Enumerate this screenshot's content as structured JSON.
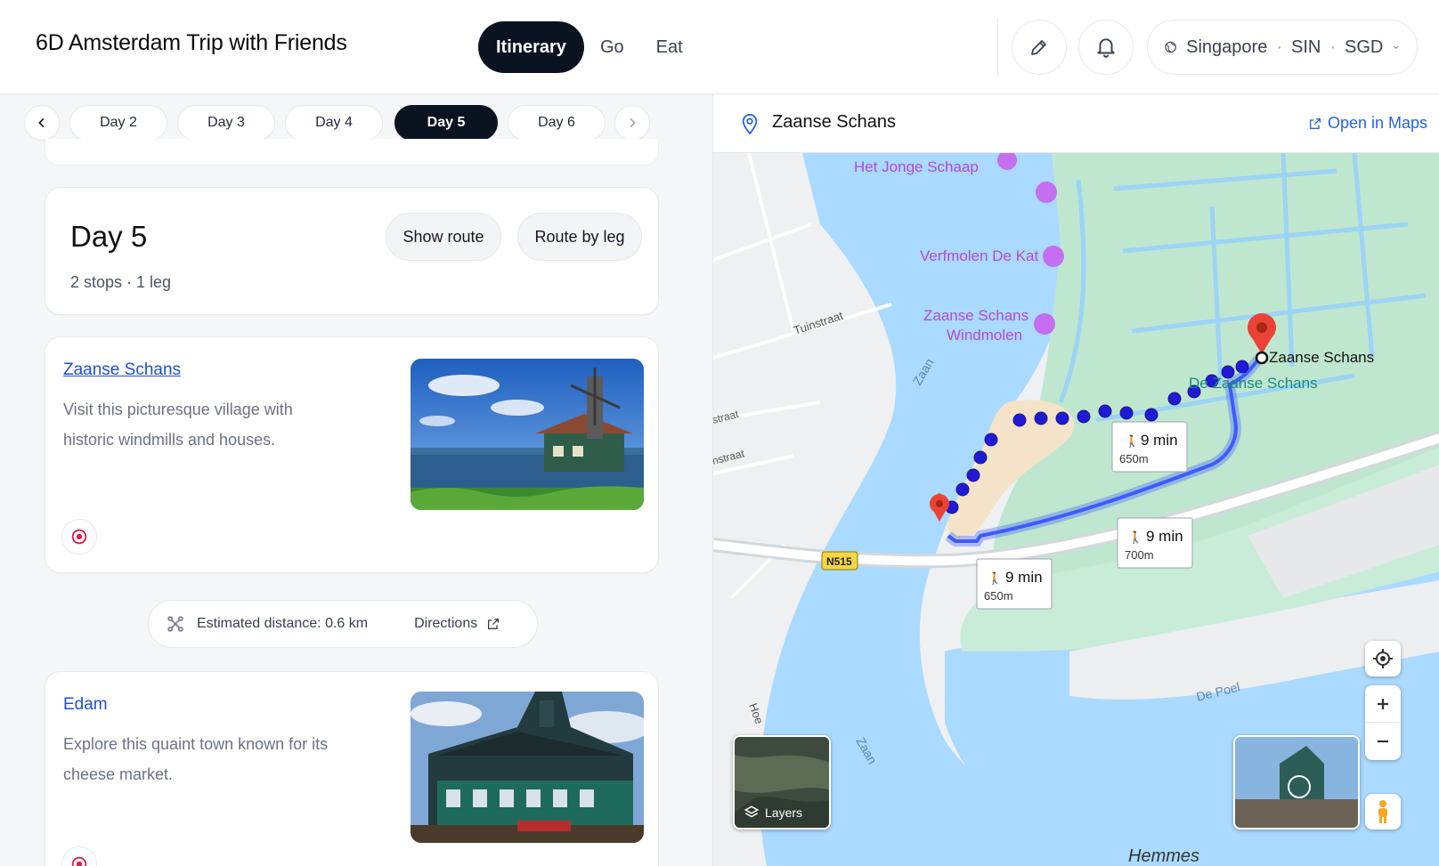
{
  "header": {
    "trip_title": "6D Amsterdam Trip with Friends",
    "tabs": [
      {
        "label": "Itinerary",
        "active": true
      },
      {
        "label": "Go",
        "active": false
      },
      {
        "label": "Eat",
        "active": false
      }
    ],
    "edit_icon": "pencil-icon",
    "notify_icon": "bell-icon",
    "locale": {
      "city": "Singapore",
      "airport": "SIN",
      "currency": "SGD",
      "icon": "globe-icon"
    }
  },
  "day_nav": {
    "days": [
      "Day 2",
      "Day 3",
      "Day 4",
      "Day 5",
      "Day 6"
    ],
    "active": "Day 5"
  },
  "day_summary": {
    "title": "Day 5",
    "subtitle": "2 stops · 1 leg",
    "show_route_label": "Show route",
    "route_by_leg_label": "Route by leg"
  },
  "stops": [
    {
      "name": "Zaanse Schans",
      "description": "Visit this picturesque village with historic windmills and houses."
    },
    {
      "name": "Edam",
      "description": "Explore this quaint town known for its cheese market."
    }
  ],
  "leg": {
    "distance": "Estimated distance: 0.6 km",
    "directions_label": "Directions"
  },
  "map": {
    "place": "Zaanse Schans",
    "open_label": "Open in Maps",
    "layers_label": "Layers",
    "poi": [
      "Het Jonge Schaap",
      "Verfmolen De Kat",
      "Zaanse Schans",
      "Windmolen"
    ],
    "streets": [
      "Tuinstraat",
      "Zaan",
      "Zaan",
      "De Poel",
      "Hemmes",
      "straat",
      "nstraat",
      "Hoe"
    ],
    "road": "N515",
    "destination_label": "Zaanse Schans",
    "area_label": "De Zaanse Schans",
    "routes": [
      {
        "time": "9 min",
        "dist": "650m"
      },
      {
        "time": "9 min",
        "dist": "700m"
      },
      {
        "time": "9 min",
        "dist": "650m"
      }
    ],
    "colors": {
      "water": "#aadaff",
      "land": "#bfe7d0",
      "route": "#3b5bfd",
      "walk_dots": "#2019d6",
      "pin": "#ea4335"
    }
  }
}
